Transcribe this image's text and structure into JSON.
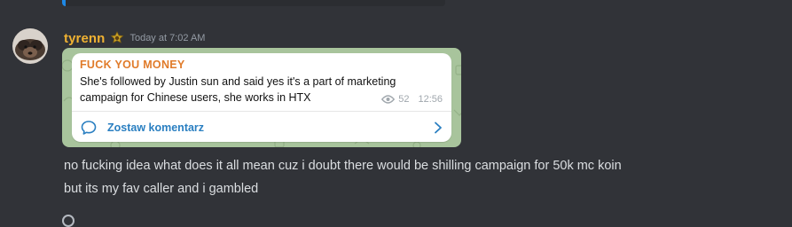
{
  "message": {
    "author": "tyrenn",
    "timestamp": "Today at 7:02 AM",
    "badge_icon": "guild-badge-icon",
    "avatar_icon": "user-avatar",
    "lines": [
      "no fucking idea what does it all mean cuz i doubt there would be shilling campaign for 50k mc koin",
      "but its my fav caller and i gambled"
    ]
  },
  "telegram_post": {
    "channel": "FUCK YOU MONEY",
    "text": "She's followed by Justin sun and said yes it's a part of marketing campaign for Chinese users, she works in HTX",
    "views": "52",
    "time": "12:56",
    "comment_label": "Zostaw komentarz",
    "accent_color": "#e07b2a",
    "link_color": "#2a7fc1"
  },
  "colors": {
    "background": "#313338",
    "username": "#f0b232",
    "text": "#dbdee1",
    "muted": "#949ba4"
  }
}
